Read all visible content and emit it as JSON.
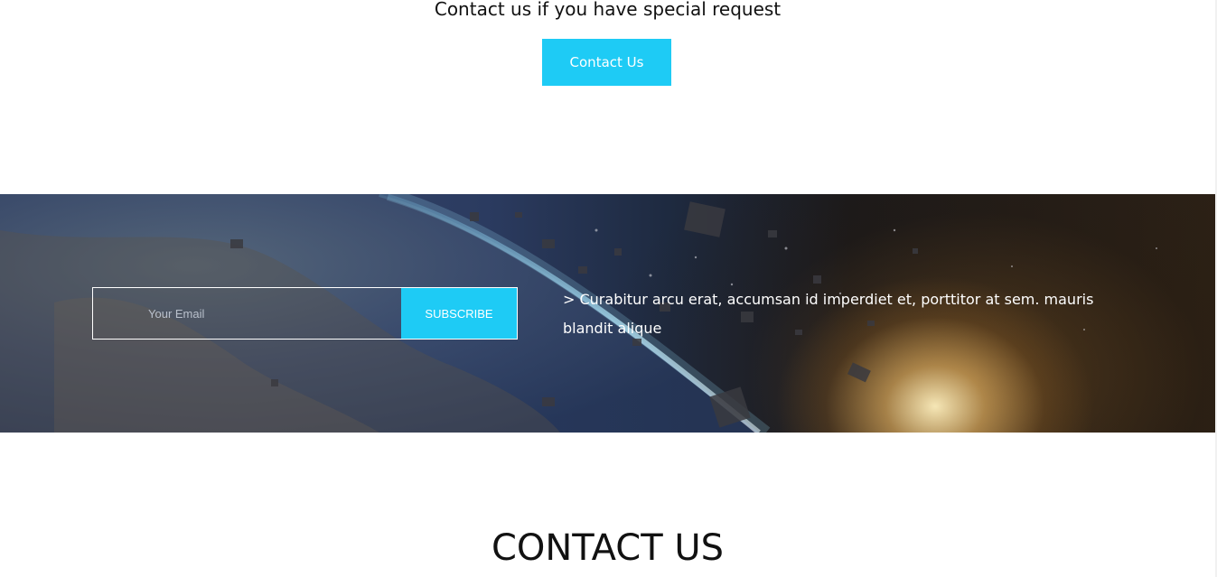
{
  "request_section": {
    "text": "Contact us if you have special request",
    "button_label": "Contact Us"
  },
  "subscribe_section": {
    "email_placeholder": "Your Email",
    "subscribe_label": "SUBSCRIBE",
    "description": "> Curabitur arcu erat, accumsan id imperdiet et, porttitor at sem. mauris blandit alique"
  },
  "contact_section": {
    "heading": "CONTACT US"
  },
  "colors": {
    "accent": "#1ecbf5",
    "text": "#111111",
    "banner_text": "#ffffff"
  }
}
